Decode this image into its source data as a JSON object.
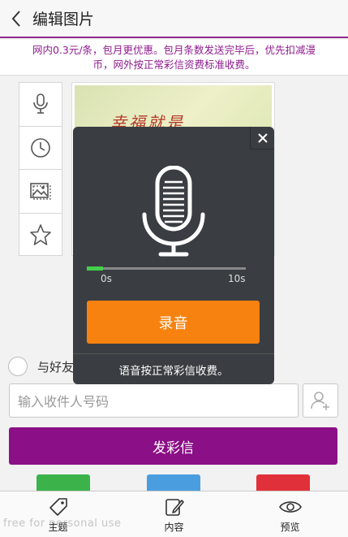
{
  "header": {
    "title": "编辑图片",
    "back_icon": "chevron-left-icon"
  },
  "notice": {
    "line1": "网内0.3元/条，包月更优惠。包月条数发送完毕后，优先扣减漫",
    "line2": "币，网外按正常彩信资费标准收费。"
  },
  "toolbar": {
    "items": [
      "microphone-icon",
      "clock-icon",
      "image-icon",
      "star-icon"
    ]
  },
  "image": {
    "text": "幸福就是"
  },
  "friend": {
    "label": "与好友"
  },
  "recipient": {
    "placeholder": "输入收件人号码",
    "contact_icon": "add-contact-icon"
  },
  "send": {
    "label": "发彩信"
  },
  "share_colors": {
    "green": "#3bb34a",
    "blue": "#4a9ee0",
    "red": "#e0313a"
  },
  "tabs": [
    {
      "label": "主题",
      "icon": "tag-icon"
    },
    {
      "label": "内容",
      "icon": "edit-icon"
    },
    {
      "label": "预览",
      "icon": "eye-icon"
    }
  ],
  "watermark": "free for personal use",
  "dialog": {
    "tick_start": "0s",
    "tick_end": "10s",
    "progress": 0.1,
    "record_label": "录音",
    "footer": "语音按正常彩信收费。"
  },
  "colors": {
    "accent": "#8b0f86",
    "record": "#f7820f",
    "dialog_bg": "#3a3e42"
  }
}
